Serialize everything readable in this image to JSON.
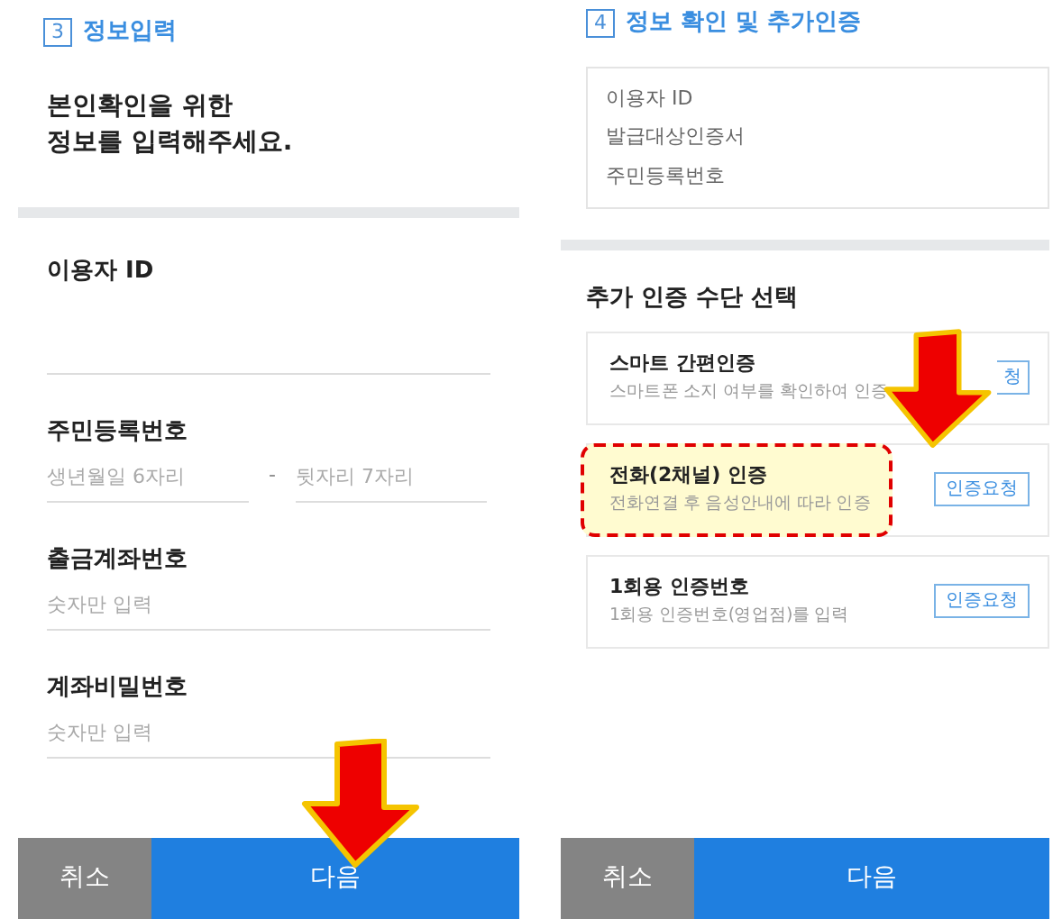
{
  "input_screen": {
    "step": "3",
    "title": "정보입력",
    "heading": "본인확인을 위한\n정보를 입력해주세요.",
    "fields": [
      {
        "kind": "single",
        "label": "이용자 ID"
      },
      {
        "kind": "split",
        "label": "주민등록번호",
        "placeholder": "생년월일 6자리",
        "separator": "-",
        "placeholder_2": "뒷자리 7자리"
      },
      {
        "kind": "single",
        "label": "출금계좌번호",
        "placeholder": "숫자만 입력"
      },
      {
        "kind": "single",
        "label": "계좌비밀번호",
        "placeholder": "숫자만 입력"
      }
    ],
    "buttons": [
      "취소",
      "다음"
    ]
  },
  "confirm_screen": {
    "step": "4",
    "title": "정보 확인 및 추가인증",
    "info_items": [
      "이용자 ID",
      "발급대상인증서",
      "주민등록번호"
    ],
    "section_title": "추가 인증 수단 선택",
    "methods": [
      {
        "name": "스마트 간편인증",
        "description": "스마트폰 소지 여부를 확인하여 인증",
        "button": "청",
        "covered": true,
        "highlighted": false
      },
      {
        "name": "전화(2채널) 인증",
        "description": "전화연결 후 음성안내에 따라 인증",
        "button": "인증요청",
        "covered": false,
        "highlighted": true
      },
      {
        "name": "1회용 인증번호",
        "description": "1회용 인증번호(영업점)를 입력",
        "button": "인증요청",
        "covered": false,
        "highlighted": false
      }
    ],
    "buttons": [
      "취소",
      "다음"
    ]
  }
}
